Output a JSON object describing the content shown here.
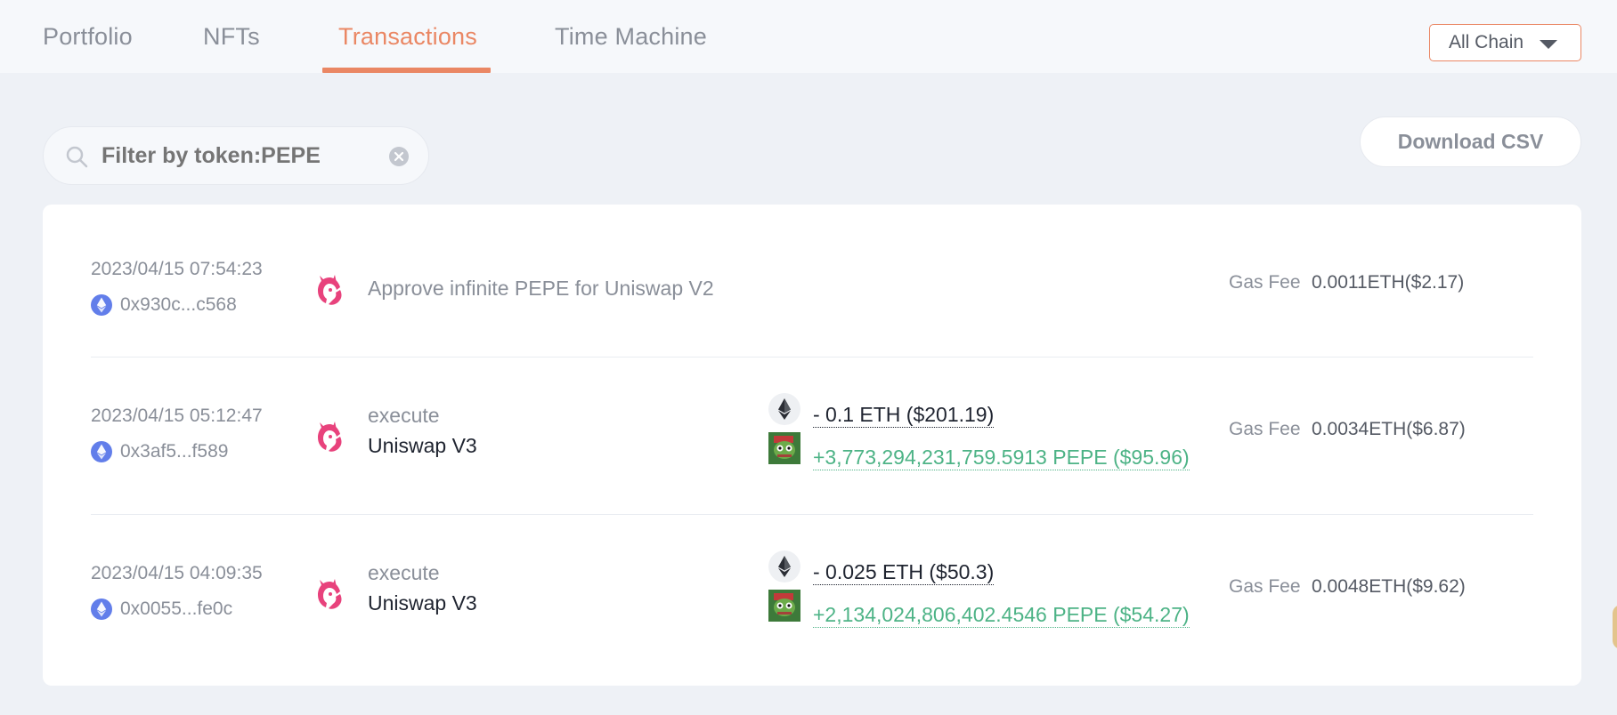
{
  "nav": {
    "tabs": [
      {
        "label": "Portfolio"
      },
      {
        "label": "NFTs"
      },
      {
        "label": "Transactions"
      },
      {
        "label": "Time Machine"
      }
    ],
    "active_tab": "Transactions",
    "chain_select": {
      "value": "All Chain"
    }
  },
  "filter": {
    "placeholder": "Filter by token:PEPE",
    "value": ""
  },
  "download_csv_label": "Download CSV",
  "colors": {
    "accent": "#ea8764",
    "positive": "#4db386",
    "uniswap_pink": "#e8427c"
  },
  "transactions": [
    {
      "timestamp": "2023/04/15 07:54:23",
      "hash": "0x930c...c568",
      "protocol_icon": "uniswap-icon",
      "action": "Approve infinite PEPE for Uniswap V2",
      "gas_label": "Gas Fee",
      "gas_value": "0.0011ETH($2.17)"
    },
    {
      "timestamp": "2023/04/15 05:12:47",
      "hash": "0x3af5...f589",
      "protocol_icon": "uniswap-icon",
      "action": "execute",
      "protocol": "Uniswap V3",
      "transfers": [
        {
          "icon": "eth-icon",
          "text": "- 0.1 ETH ($201.19)",
          "direction": "out"
        },
        {
          "icon": "pepe-icon",
          "text": "+3,773,294,231,759.5913 PEPE ($95.96)",
          "direction": "in"
        }
      ],
      "gas_label": "Gas Fee",
      "gas_value": "0.0034ETH($6.87)"
    },
    {
      "timestamp": "2023/04/15 04:09:35",
      "hash": "0x0055...fe0c",
      "protocol_icon": "uniswap-icon",
      "action": "execute",
      "protocol": "Uniswap V3",
      "transfers": [
        {
          "icon": "eth-icon",
          "text": "- 0.025 ETH ($50.3)",
          "direction": "out"
        },
        {
          "icon": "pepe-icon",
          "text": "+2,134,024,806,402.4546 PEPE ($54.27)",
          "direction": "in"
        }
      ],
      "gas_label": "Gas Fee",
      "gas_value": "0.0048ETH($9.62)"
    }
  ]
}
